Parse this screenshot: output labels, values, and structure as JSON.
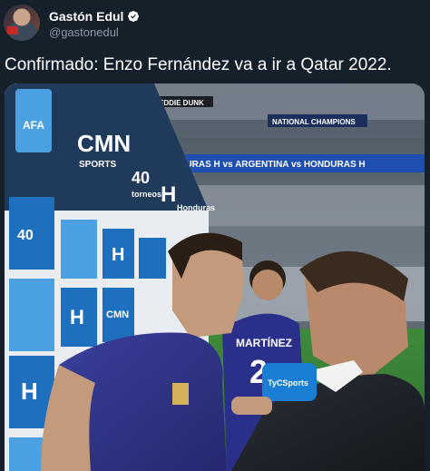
{
  "tweet": {
    "author": {
      "display_name": "Gastón Edul",
      "handle": "@gastonedul",
      "verified": true,
      "avatar_icon": "profile-photo"
    },
    "text": "Confirmado: Enzo Fernández va a ir a Qatar 2022.",
    "media": {
      "type": "photo",
      "board_texts": {
        "afa": "AFA",
        "cmn": "CMN",
        "sports": "SPORTS",
        "forty": "40",
        "torneos": "torneos",
        "honduras": "Honduras",
        "big_h": "H"
      },
      "banner_texts": {
        "eddie": "EDDIE DUNK",
        "national": "NATIONAL CHAMPIONS",
        "led_ribbon": "HONDURAS H vs ARGENTINA vs HONDURAS H"
      },
      "player_back": {
        "name": "MARTÍNEZ",
        "number": "2"
      },
      "mic_label": "TyCSports"
    },
    "colors": {
      "background": "#15202b",
      "text_primary": "#ffffff",
      "text_secondary": "#8b98a5",
      "verified": "#ffffff",
      "argentina_blue": "#5b7fcf",
      "board_blue": "#1f6fbf"
    }
  }
}
